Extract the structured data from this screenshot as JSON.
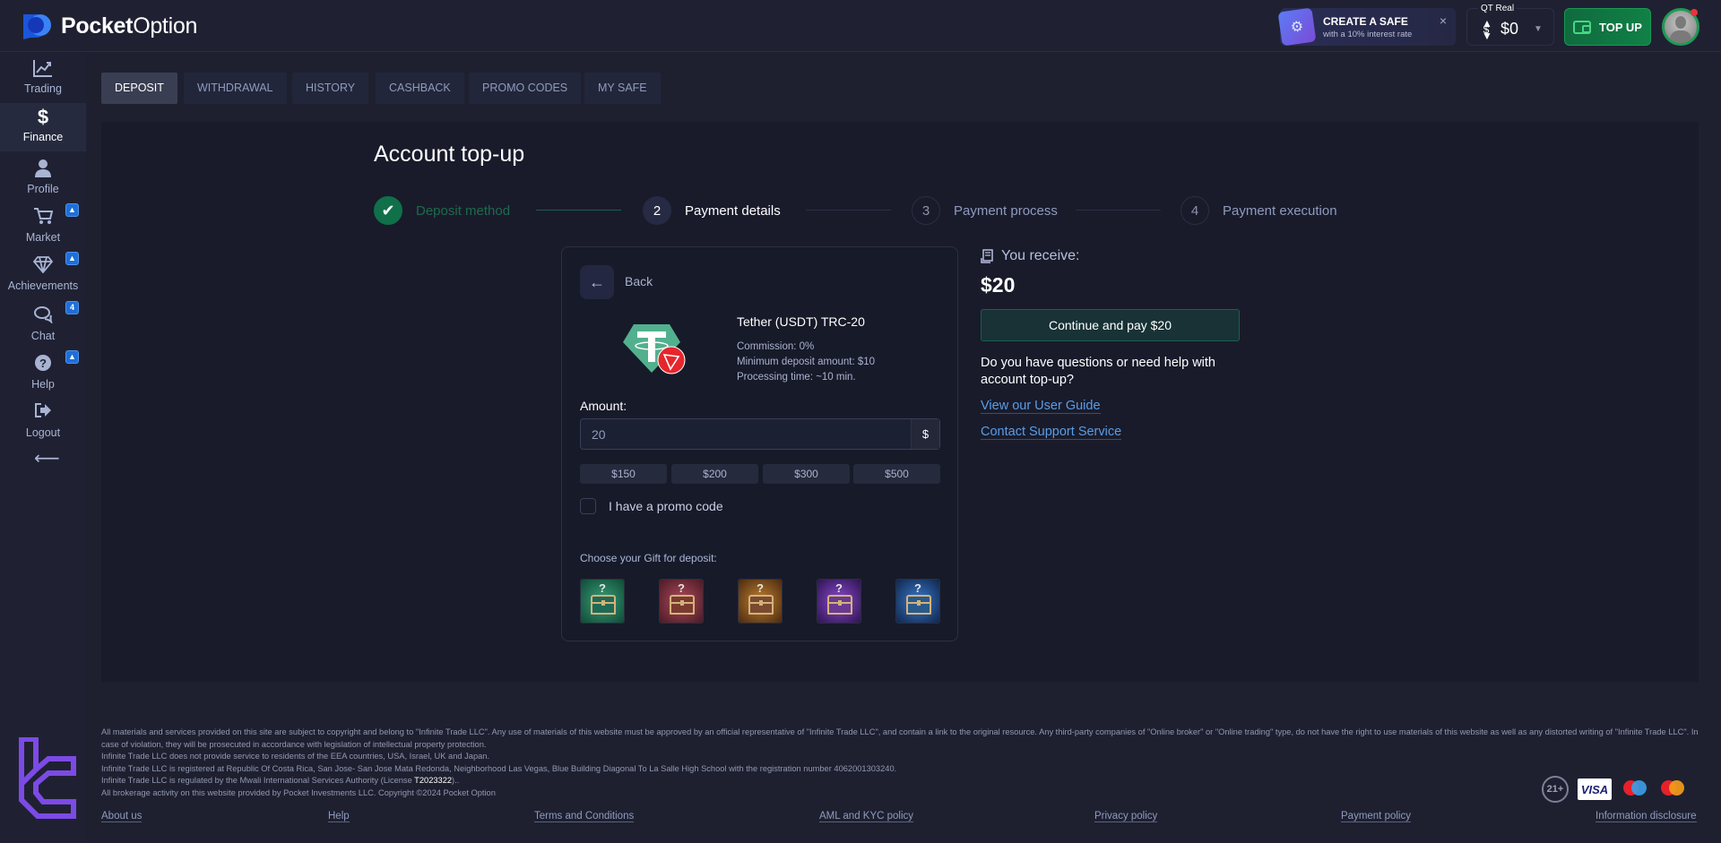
{
  "app": {
    "brand_bold": "Pocket",
    "brand_light": "Option"
  },
  "header": {
    "safe_promo": {
      "title": "CREATE A SAFE",
      "subtitle": "with a 10% interest rate",
      "close_icon": "×"
    },
    "account": {
      "label": "QT Real",
      "balance": "$0",
      "arrows_icon": "⬍$"
    },
    "topup_label": "TOP UP",
    "colors": {
      "accent_green": "#118046",
      "notification_red": "#e5343d"
    }
  },
  "sidebar": {
    "items": [
      {
        "label": "Trading",
        "icon": "chart-line-icon",
        "glyph": "📈",
        "active": false,
        "badge": ""
      },
      {
        "label": "Finance",
        "icon": "dollar-icon",
        "glyph": "$",
        "active": true,
        "badge": ""
      },
      {
        "label": "Profile",
        "icon": "user-icon",
        "glyph": "👤",
        "active": false,
        "badge": ""
      },
      {
        "label": "Market",
        "icon": "cart-icon",
        "glyph": "🛒",
        "active": false,
        "badge": "🔔"
      },
      {
        "label": "Achievements",
        "icon": "diamond-icon",
        "glyph": "◇",
        "active": false,
        "badge": "🔔"
      },
      {
        "label": "Chat",
        "icon": "chat-icon",
        "glyph": "💬",
        "active": false,
        "badge": "4"
      },
      {
        "label": "Help",
        "icon": "help-icon",
        "glyph": "?",
        "active": false,
        "badge": "🔔"
      },
      {
        "label": "Logout",
        "icon": "logout-icon",
        "glyph": "⇥",
        "active": false,
        "badge": ""
      }
    ],
    "collapse_icon": "⟵"
  },
  "tabs": [
    {
      "label": "Deposit",
      "active": true
    },
    {
      "label": "Withdrawal",
      "active": false
    },
    {
      "label": "History",
      "active": false
    },
    {
      "label": "Cashback",
      "active": false
    },
    {
      "label": "Promo codes",
      "active": false
    },
    {
      "label": "My safe",
      "active": false
    }
  ],
  "page": {
    "title": "Account top-up",
    "steps": [
      {
        "number": "✔",
        "label": "Deposit method",
        "state": "done"
      },
      {
        "number": "2",
        "label": "Payment details",
        "state": "current"
      },
      {
        "number": "3",
        "label": "Payment process",
        "state": "pending"
      },
      {
        "number": "4",
        "label": "Payment execution",
        "state": "pending"
      }
    ]
  },
  "payment_card": {
    "back_icon": "←",
    "back_label": "Back",
    "method_name": "Tether (USDT) TRC-20",
    "commission": "Commission: 0%",
    "min_deposit": "Minimum deposit amount: $10",
    "processing_time": "Processing time: ~10 min.",
    "amount_label": "Amount:",
    "amount_value": "20",
    "amount_currency": "$",
    "presets": [
      "$150",
      "$200",
      "$300",
      "$500"
    ],
    "promo_label": "I have a promo code",
    "promo_checked": false,
    "gift_label": "Choose your Gift for deposit:",
    "gifts": [
      {
        "name": "green-chest",
        "color": "#1f7a5a",
        "glyph": "?"
      },
      {
        "name": "red-chest",
        "color": "#7a2a3a",
        "glyph": "?"
      },
      {
        "name": "gold-chest",
        "color": "#8a5a20",
        "glyph": "?"
      },
      {
        "name": "purple-chest",
        "color": "#5a2a8a",
        "glyph": "?"
      },
      {
        "name": "blue-chest",
        "color": "#1f4f8a",
        "glyph": "?"
      }
    ]
  },
  "summary": {
    "receive_label": "You receive:",
    "receive_amount": "$20",
    "continue_label": "Continue and pay $20",
    "help_question": "Do you have questions or need help with account top-up?",
    "links": [
      "View our User Guide",
      "Contact Support Service"
    ]
  },
  "footer": {
    "legal": [
      "All materials and services provided on this site are subject to copyright and belong to \"Infinite Trade LLC\". Any use of materials of this website must be approved by an official representative of \"Infinite Trade LLC\", and contain a link to the original resource. Any third-party companies of \"Online broker\" or \"Online trading\" type, do not have the right to use materials of this website as well as any distorted writing of \"Infinite Trade LLC\". In case of violation, they will be prosecuted in accordance with legislation of intellectual property protection.",
      "Infinite Trade LLC does not provide service to residents of the EEA countries, USA, Israel, UK and Japan.",
      "Infinite Trade LLC is registered at Republic Of Costa Rica, San Jose- San Jose Mata Redonda, Neighborhood Las Vegas, Blue Building Diagonal To La Salle High School with the registration number 4062001303240."
    ],
    "regulated_prefix": "Infinite Trade LLC is regulated by the Mwali International Services Authority (License ",
    "license": "T2023322",
    "regulated_suffix": ")..",
    "copyright": "All brokerage activity on this website provided by Pocket Investments LLC. Copyright ©2024 Pocket Option",
    "links": [
      "About us",
      "Help",
      "Terms and Conditions",
      "AML and KYC policy",
      "Privacy policy",
      "Payment policy",
      "Information disclosure"
    ],
    "badges": {
      "age": "21+",
      "visa": "VISA"
    }
  }
}
